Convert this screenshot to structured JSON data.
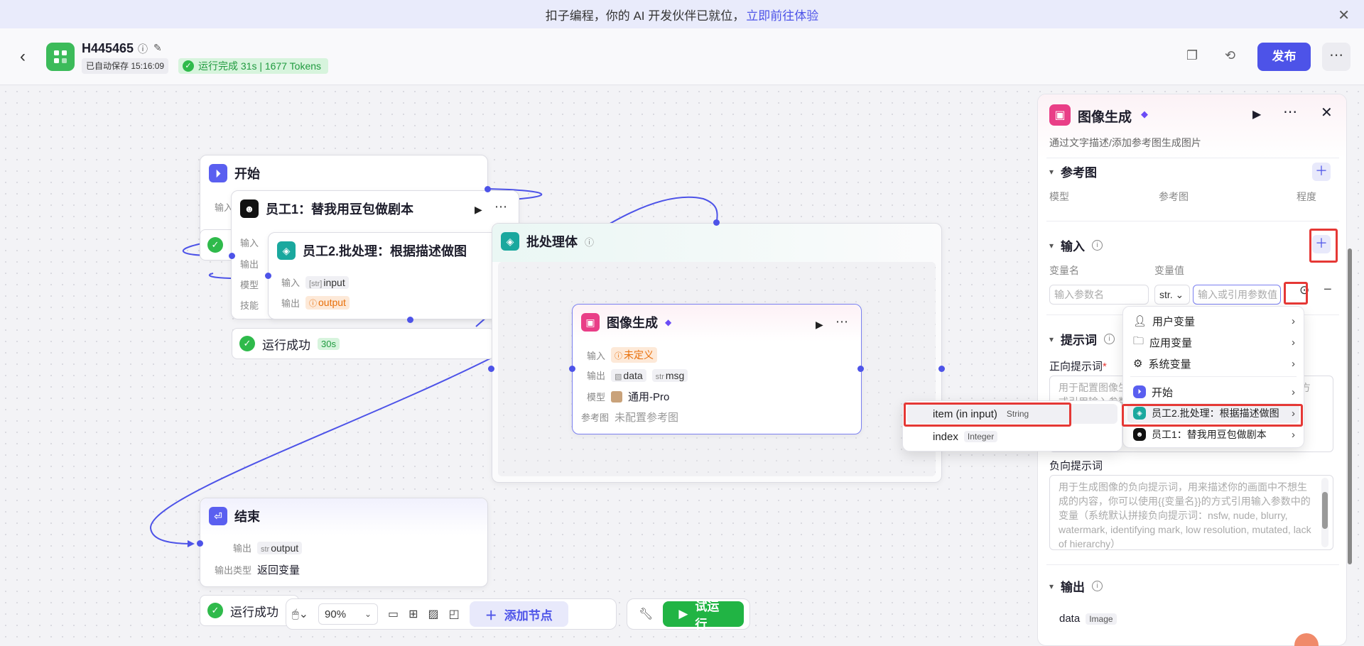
{
  "banner": {
    "text": "扣子编程，你的 AI 开发伙伴已就位，",
    "link": "立即前往体验"
  },
  "header": {
    "app_name": "H445465",
    "autosave": "已自动保存 15:16:09",
    "run_status": "运行完成 31s | 1677 Tokens",
    "publish": "发布"
  },
  "nodes": {
    "start": {
      "title": "开始",
      "input_label": "输入"
    },
    "employee1": {
      "title": "员工1：替我用豆包做剧本",
      "labels": [
        "输入",
        "输出",
        "模型",
        "技能"
      ],
      "status": "运行成功",
      "duration": "30s"
    },
    "employee2": {
      "title": "员工2.批处理：根据描述做图",
      "input_label": "输入",
      "input_value": "input",
      "output_label": "输出",
      "output_value": "output"
    },
    "batch": {
      "title": "批处理体"
    },
    "image_gen": {
      "title": "图像生成",
      "input_label": "输入",
      "input_value": "未定义",
      "output_label": "输出",
      "output_values": [
        "data",
        "msg"
      ],
      "model_label": "模型",
      "model_value": "通用-Pro",
      "ref_label": "参考图",
      "ref_value": "未配置参考图"
    },
    "end": {
      "title": "结束",
      "output_label": "输出",
      "output_value": "output",
      "type_label": "输出类型",
      "type_value": "返回变量",
      "status": "运行成功"
    }
  },
  "toolbar": {
    "zoom": "90%",
    "add_node": "添加节点",
    "try_run": "试运行"
  },
  "var_menu": {
    "items": [
      "用户变量",
      "应用变量",
      "系统变量",
      "开始",
      "员工2.批处理：根据描述做图",
      "员工1：替我用豆包做剧本"
    ]
  },
  "sub_menu": {
    "items": [
      {
        "name": "item (in input)",
        "type": "String"
      },
      {
        "name": "index",
        "type": "Integer"
      }
    ]
  },
  "panel": {
    "title": "图像生成",
    "desc": "通过文字描述/添加参考图生成图片",
    "ref_section": "参考图",
    "ref_cols": [
      "模型",
      "参考图",
      "程度"
    ],
    "input_section": "输入",
    "input_cols": [
      "变量名",
      "变量值"
    ],
    "var_name_placeholder": "输入参数名",
    "var_type": "str.",
    "var_value_placeholder": "输入或引用参数值",
    "prompt_section": "提示词",
    "positive_label": "正向提示词",
    "positive_placeholder": "用于配置图像生成的正向提示词，可以使用{{变量名}}的方式引用输入参数中的变量",
    "negative_label": "负向提示词",
    "negative_placeholder": "用于生成图像的负向提示词，用来描述你的画面中不想生成的内容，你可以使用{{变量名}}的方式引用输入参数中的变量（系统默认拼接负向提示词：nsfw, nude, blurry, watermark, identifying mark, low resolution, mutated, lack of hierarchy）",
    "output_section": "输出",
    "output_name": "data",
    "output_type": "Image"
  },
  "colors": {
    "brand": "#4d53e8",
    "success": "#2fba4b",
    "highlight": "#e53835",
    "warning": "#e8700b"
  }
}
